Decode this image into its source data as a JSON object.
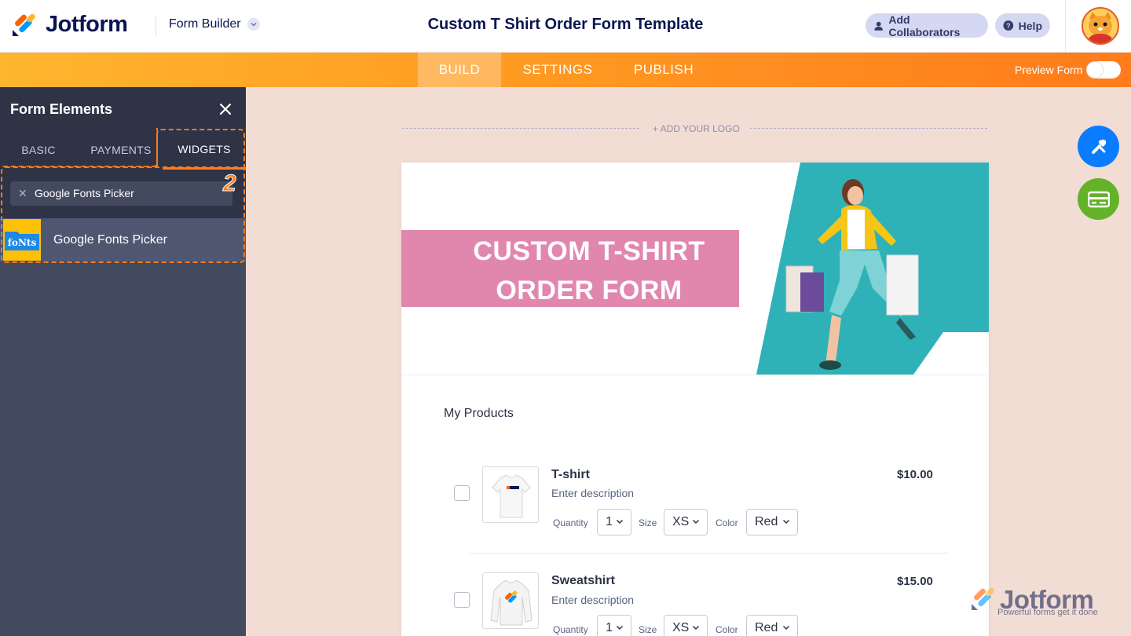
{
  "header": {
    "brand": "Jotform",
    "builder_menu": "Form Builder",
    "form_title": "Custom T Shirt Order Form Template",
    "add_collaborators": "Add Collaborators",
    "help": "Help"
  },
  "nav": {
    "tabs": [
      "BUILD",
      "SETTINGS",
      "PUBLISH"
    ],
    "active_tab": "BUILD",
    "preview_label": "Preview Form",
    "preview_on": false
  },
  "panel": {
    "title": "Form Elements",
    "tabs": [
      "BASIC",
      "PAYMENTS",
      "WIDGETS"
    ],
    "active_tab": "WIDGETS",
    "search_value": "Google Fonts Picker",
    "step_number": "2",
    "results": [
      {
        "label": "Google Fonts Picker",
        "thumb_text": "foNts"
      }
    ]
  },
  "canvas": {
    "add_logo": "+ ADD YOUR LOGO",
    "hero_title_line1": "CUSTOM T-SHIRT",
    "hero_title_line2": "ORDER FORM",
    "section_title": "My Products",
    "products": [
      {
        "name": "T-shirt",
        "description": "Enter description",
        "price": "$10.00",
        "options": {
          "quantity_label": "Quantity",
          "quantity": "1",
          "size_label": "Size",
          "size": "XS",
          "color_label": "Color",
          "color": "Red"
        }
      },
      {
        "name": "Sweatshirt",
        "description": "Enter description",
        "price": "$15.00",
        "options": {
          "quantity_label": "Quantity",
          "quantity": "1",
          "size_label": "Size",
          "size": "XS",
          "color_label": "Color",
          "color": "Red"
        }
      }
    ]
  },
  "watermark": {
    "brand": "Jotform",
    "tagline": "Powerful forms get it done"
  },
  "colors": {
    "brand_navy": "#0a1551",
    "nav_orange": "#ff7b1c",
    "panel_dark": "#2e3346",
    "hero_pink": "#e187ad",
    "hero_teal": "#2fb2b7",
    "canvas_bg": "#f2ddd5",
    "fab_blue": "#0a7cff",
    "fab_green": "#64b22a"
  },
  "icons": [
    "jotform-logo-icon",
    "chevron-down-icon",
    "user-icon",
    "help-icon",
    "avatar-cat-icon",
    "close-icon",
    "clear-search-icon",
    "fonts-widget-icon",
    "design-paint-icon",
    "payment-card-icon"
  ]
}
